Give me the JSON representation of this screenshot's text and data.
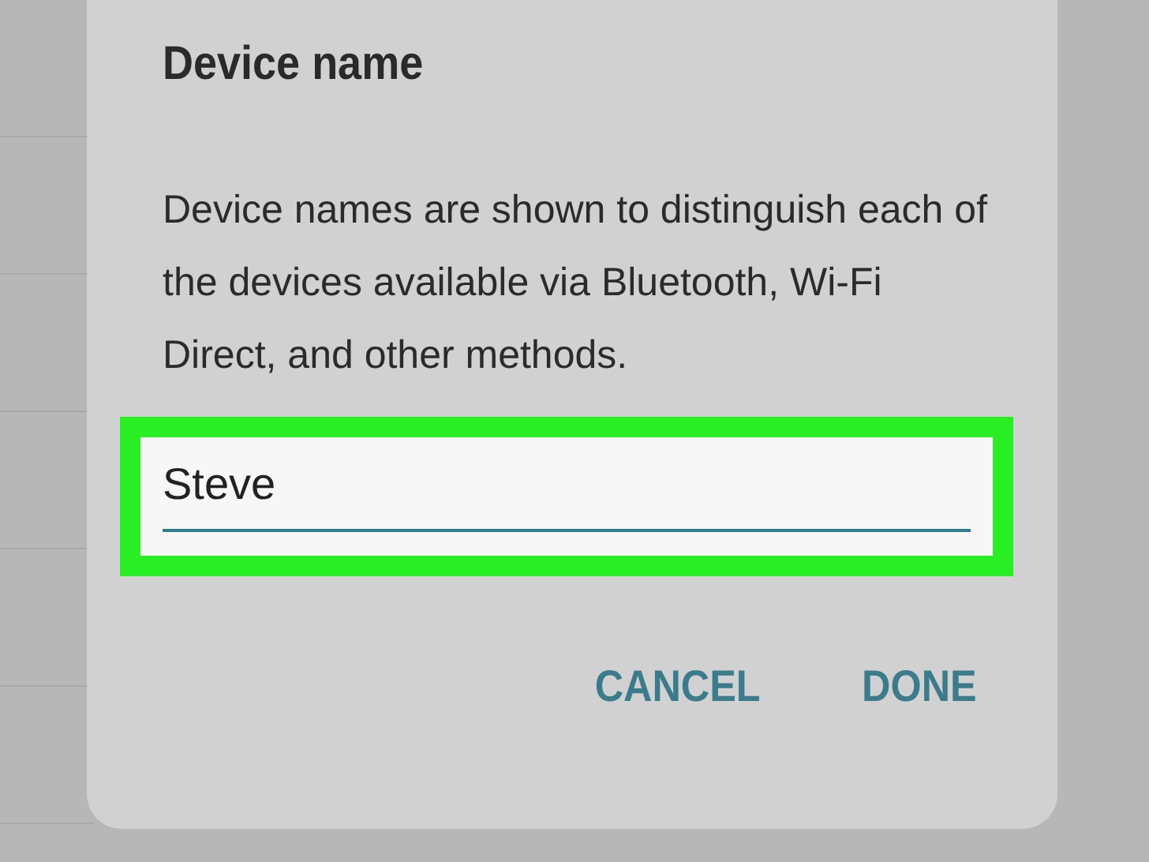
{
  "dialog": {
    "title": "Device name",
    "message": "Device names are shown to distinguish each of the devices available via Bluetooth, Wi-Fi Direct, and other methods.",
    "field": {
      "value": "Steve",
      "highlighted": true
    },
    "buttons": [
      {
        "label": "CANCEL"
      },
      {
        "label": "DONE"
      }
    ]
  }
}
